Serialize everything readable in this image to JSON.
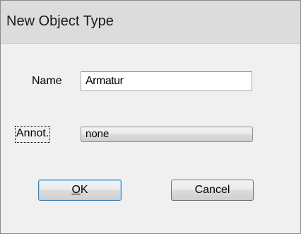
{
  "window": {
    "title": "New Object Type"
  },
  "form": {
    "name_label": "Name",
    "name_value": "Armatur",
    "annot_label": "Annot.",
    "annot_value": "none"
  },
  "buttons": {
    "ok_mnemonic": "O",
    "ok_rest": "K",
    "cancel_label": "Cancel"
  }
}
